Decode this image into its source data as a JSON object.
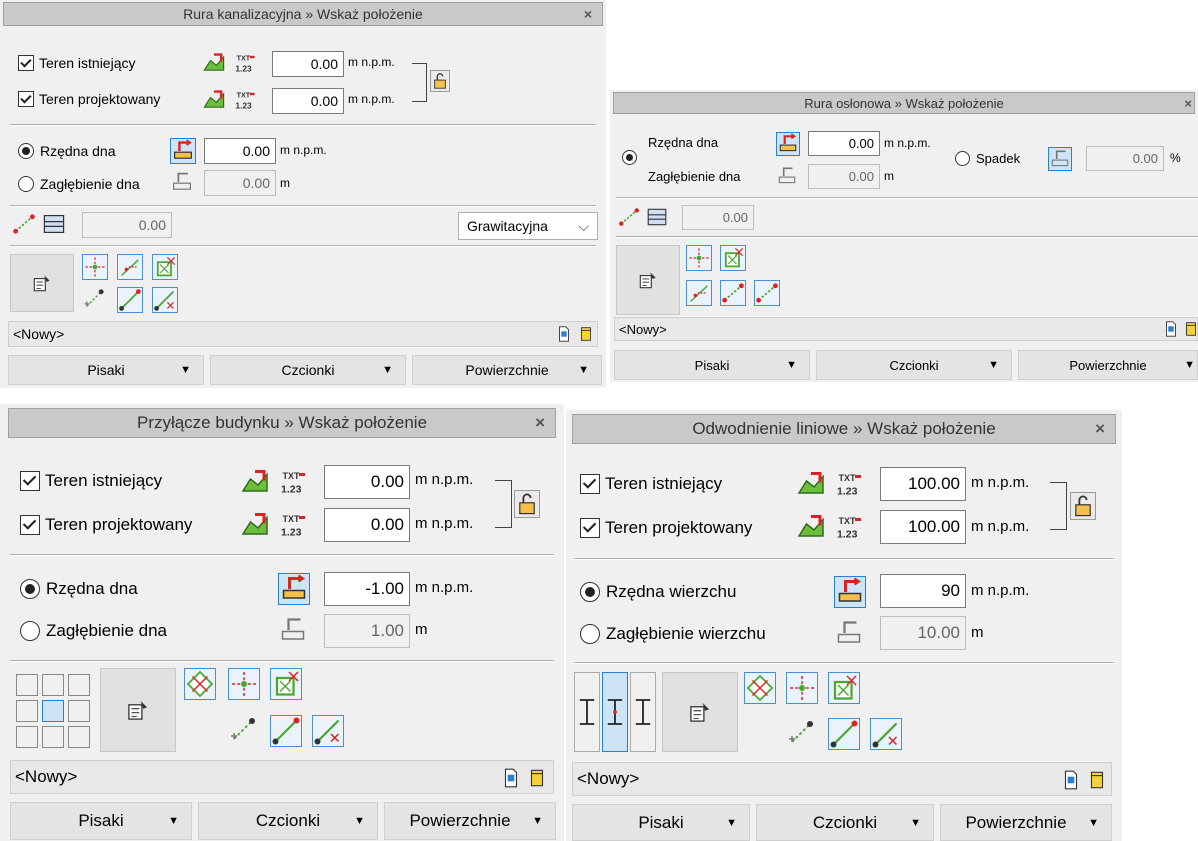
{
  "p1": {
    "title": "Rura kanalizacyjna » Wskaż położenie",
    "close": "×",
    "teren_ist": {
      "label": "Teren istniejący",
      "value": "0.00",
      "unit": "m n.p.m."
    },
    "teren_proj": {
      "label": "Teren projektowany",
      "value": "0.00",
      "unit": "m n.p.m."
    },
    "rzedna": {
      "label": "Rzędna dna",
      "value": "0.00",
      "unit": "m n.p.m."
    },
    "zaglebienie": {
      "label": "Zagłębienie dna",
      "value": "0.00",
      "unit": "m"
    },
    "slope_value": "0.00",
    "combo": "Grawitacyjna",
    "list": "<Nowy>",
    "tabs": [
      "Pisaki",
      "Czcionki",
      "Powierzchnie"
    ]
  },
  "p2": {
    "title": "Rura osłonowa » Wskaż położenie",
    "close": "×",
    "rzedna": {
      "label": "Rzędna dna",
      "value": "0.00",
      "unit": "m n.p.m."
    },
    "zaglebienie": {
      "label": "Zagłębienie dna",
      "value": "0.00",
      "unit": "m"
    },
    "spadek": {
      "label": "Spadek",
      "value": "0.00",
      "unit": "%"
    },
    "slope_value": "0.00",
    "list": "<Nowy>",
    "tabs": [
      "Pisaki",
      "Czcionki",
      "Powierzchnie"
    ]
  },
  "p3": {
    "title": "Przyłącze budynku » Wskaż położenie",
    "close": "×",
    "teren_ist": {
      "label": "Teren istniejący",
      "value": "0.00",
      "unit": "m n.p.m."
    },
    "teren_proj": {
      "label": "Teren projektowany",
      "value": "0.00",
      "unit": "m n.p.m."
    },
    "rzedna": {
      "label": "Rzędna dna",
      "value": "-1.00",
      "unit": "m n.p.m."
    },
    "zaglebienie": {
      "label": "Zagłębienie dna",
      "value": "1.00",
      "unit": "m"
    },
    "list": "<Nowy>",
    "tabs": [
      "Pisaki",
      "Czcionki",
      "Powierzchnie"
    ]
  },
  "p4": {
    "title": "Odwodnienie liniowe » Wskaż położenie",
    "close": "×",
    "teren_ist": {
      "label": "Teren istniejący",
      "value": "100.00",
      "unit": "m n.p.m."
    },
    "teren_proj": {
      "label": "Teren projektowany",
      "value": "100.00",
      "unit": "m n.p.m."
    },
    "rzedna": {
      "label": "Rzędna wierzchu",
      "value": "90",
      "unit": "m n.p.m."
    },
    "zaglebienie": {
      "label": "Zagłębienie wierzchu",
      "value": "10.00",
      "unit": "m"
    },
    "list": "<Nowy>",
    "tabs": [
      "Pisaki",
      "Czcionki",
      "Powierzchnie"
    ]
  },
  "colors": {
    "accent": "#2a7fd4",
    "panel_bg": "#f0f0f0",
    "titlebar_bg": "#c9c9c9"
  }
}
